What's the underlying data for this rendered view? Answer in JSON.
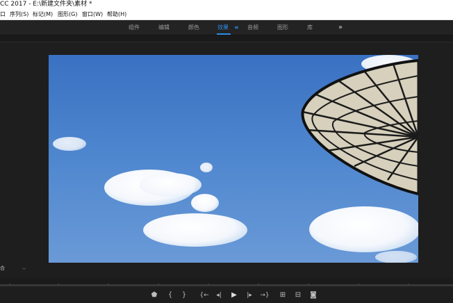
{
  "app": {
    "title": "CC 2017 - E:\\新建文件夹\\素材 *"
  },
  "menu": {
    "items": [
      "序列(S)",
      "标记(M)",
      "图形(G)",
      "窗口(W)",
      "帮助(H)"
    ],
    "clipped_prefix": "口"
  },
  "workspaces": {
    "tabs": [
      "组件",
      "编辑",
      "颜色",
      "效果",
      "音频",
      "图形",
      "库"
    ],
    "active": "效果",
    "menu_glyph": "≡",
    "overflow_glyph": "»"
  },
  "monitor": {
    "zoom_label": "合",
    "zoom_chevron": "⌵"
  },
  "transport": {
    "buttons": [
      {
        "name": "add-marker-button",
        "icon": "marker-icon",
        "glyph": "⬟"
      },
      {
        "name": "mark-in-button",
        "icon": "bracket-left-icon",
        "glyph": "{"
      },
      {
        "name": "mark-out-button",
        "icon": "bracket-right-icon",
        "glyph": "}"
      },
      {
        "name": "go-to-in-button",
        "icon": "go-to-in-icon",
        "glyph": "{←"
      },
      {
        "name": "step-back-button",
        "icon": "step-back-icon",
        "glyph": "◂|"
      },
      {
        "name": "play-button",
        "icon": "play-icon",
        "glyph": "▶"
      },
      {
        "name": "step-forward-button",
        "icon": "step-forward-icon",
        "glyph": "|▸"
      },
      {
        "name": "go-to-out-button",
        "icon": "go-to-out-icon",
        "glyph": "→}"
      },
      {
        "name": "insert-button",
        "icon": "insert-icon",
        "glyph": "⊞"
      },
      {
        "name": "overwrite-button",
        "icon": "overwrite-icon",
        "glyph": "⊟"
      },
      {
        "name": "export-frame-button",
        "icon": "camera-icon",
        "glyph": "◙"
      }
    ]
  },
  "colors": {
    "accent": "#2d8ceb",
    "panel": "#1e1e1e",
    "workspace_bar": "#232323"
  }
}
